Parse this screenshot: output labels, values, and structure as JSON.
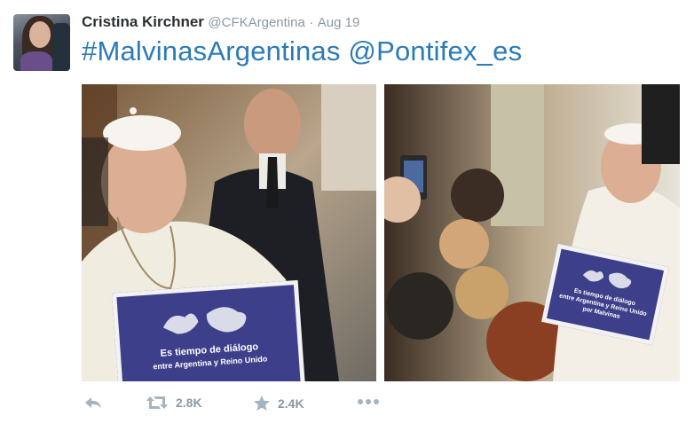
{
  "tweet": {
    "author_name": "Cristina Kirchner",
    "author_handle": "@CFKArgentina",
    "separator": "·",
    "date": "Aug 19",
    "hashtag": "#MalvinasArgentinas",
    "mention": "@Pontifex_es"
  },
  "photos": {
    "left_sign_line1": "Es tiempo de diálogo",
    "left_sign_line2": "entre Argentina y Reino Unido",
    "right_sign_line1": "Es tiempo de diálogo",
    "right_sign_line2": "entre Argentina y Reino Unido",
    "right_sign_line3": "por Malvinas"
  },
  "actions": {
    "retweet_count": "2.8K",
    "favorite_count": "2.4K",
    "icons": [
      "reply-icon",
      "retweet-icon",
      "favorite-star-icon",
      "more-icon"
    ]
  },
  "colors": {
    "link_blue": "#2b7bb9",
    "muted_gray": "#8899a6",
    "icon_gray": "#a6b4bf",
    "sign_blue": "#3d3f8a"
  }
}
